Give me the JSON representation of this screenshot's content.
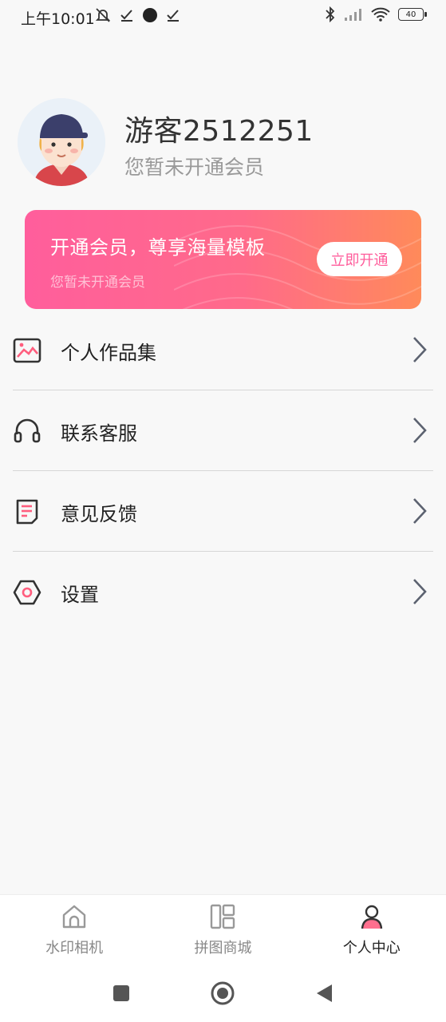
{
  "status_bar": {
    "time": "上午10:01",
    "battery": "40",
    "icons": [
      "mute-icon",
      "check-icon",
      "dot-icon",
      "check-icon",
      "bluetooth-icon",
      "signal-icon",
      "wifi-icon",
      "battery-icon"
    ]
  },
  "profile": {
    "username": "游客2512251",
    "membership_status": "您暂未开通会员"
  },
  "vip_card": {
    "title": "开通会员，尊享海量模板",
    "subtitle": "您暂未开通会员",
    "button_label": "立即开通",
    "colors": {
      "start": "#ff5e9c",
      "end": "#ff8a5a"
    }
  },
  "menu": {
    "items": [
      {
        "label": "个人作品集",
        "icon": "image-icon"
      },
      {
        "label": "联系客服",
        "icon": "headset-icon"
      },
      {
        "label": "意见反馈",
        "icon": "feedback-icon"
      },
      {
        "label": "设置",
        "icon": "settings-icon"
      }
    ]
  },
  "tabbar": {
    "tabs": [
      {
        "label": "水印相机",
        "icon": "home-icon",
        "active": false
      },
      {
        "label": "拼图商城",
        "icon": "layout-icon",
        "active": false
      },
      {
        "label": "个人中心",
        "icon": "user-icon",
        "active": true
      }
    ]
  },
  "accent_color": "#ff5e9c"
}
